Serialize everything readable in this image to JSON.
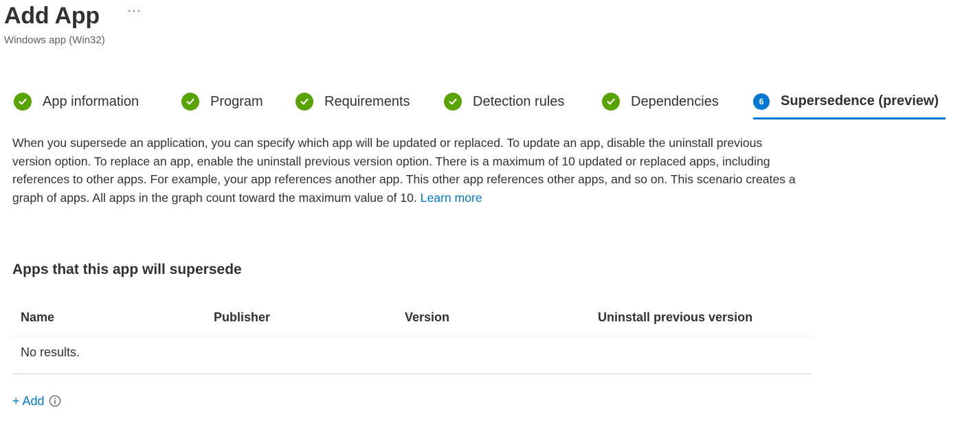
{
  "header": {
    "title": "Add App",
    "more_label": "···",
    "subtitle": "Windows app (Win32)"
  },
  "steps": [
    {
      "label": "App information",
      "status": "complete",
      "icon": "checkmark-icon"
    },
    {
      "label": "Program",
      "status": "complete",
      "icon": "checkmark-icon"
    },
    {
      "label": "Requirements",
      "status": "complete",
      "icon": "checkmark-icon"
    },
    {
      "label": "Detection rules",
      "status": "complete",
      "icon": "checkmark-icon"
    },
    {
      "label": "Dependencies",
      "status": "complete",
      "icon": "checkmark-icon"
    },
    {
      "label": "Supersedence (preview)",
      "status": "active",
      "number": "6"
    }
  ],
  "description": {
    "text": "When you supersede an application, you can specify which app will be updated or replaced. To update an app, disable the uninstall previous version option. To replace an app, enable the uninstall previous version option. There is a maximum of 10 updated or replaced apps, including references to other apps. For example, your app references another app. This other app references other apps, and so on. This scenario creates a graph of apps. All apps in the graph count toward the maximum value of 10.",
    "link_label": "Learn more"
  },
  "section": {
    "title": "Apps that this app will supersede"
  },
  "table": {
    "columns": [
      "Name",
      "Publisher",
      "Version",
      "Uninstall previous version"
    ],
    "empty_text": "No results."
  },
  "add": {
    "label": "+ Add",
    "info_icon": "info-icon"
  },
  "colors": {
    "accent": "#0078d4",
    "success": "#57a300",
    "text": "#323130",
    "subtle_text": "#605e5c"
  }
}
